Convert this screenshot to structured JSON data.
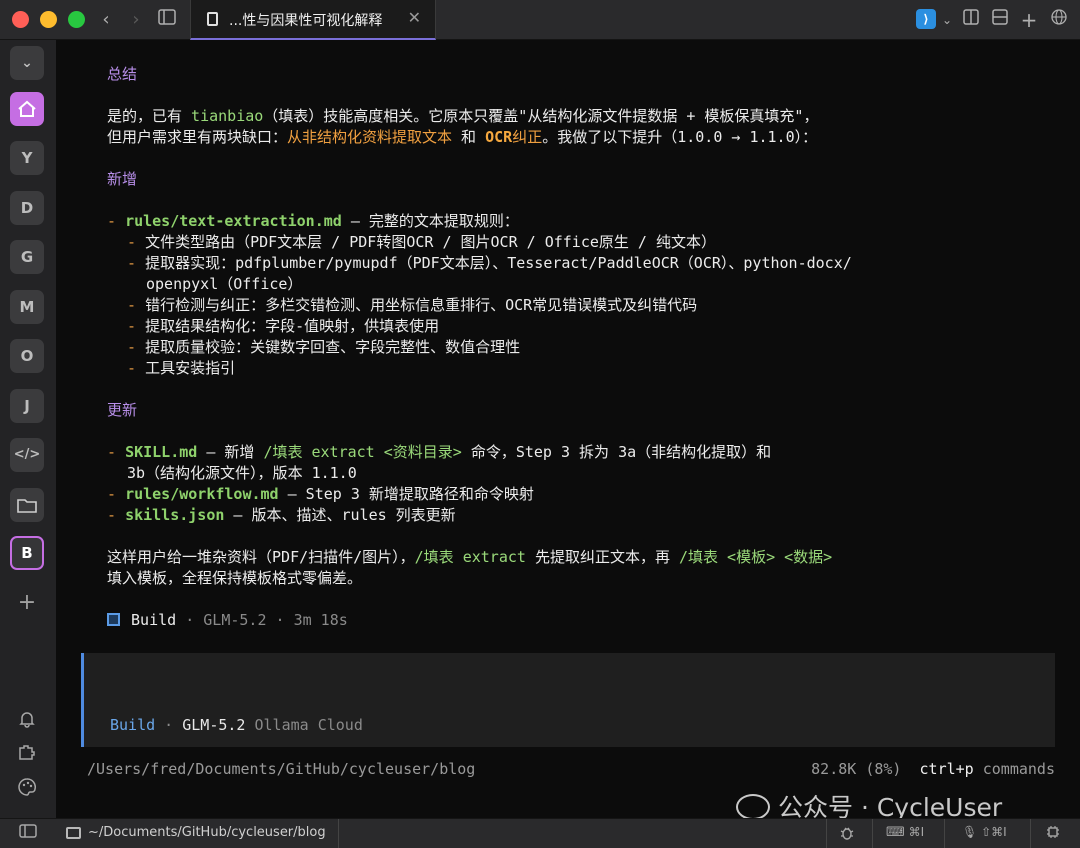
{
  "tab": {
    "title": "...性与因果性可视化解释",
    "close": "✕"
  },
  "sidebar": {
    "collapse": "⌄",
    "home": "⌂",
    "workspaces": [
      "Y",
      "D",
      "G",
      "M",
      "O",
      "J",
      "</>",
      "▭",
      "B"
    ],
    "add": "+",
    "bell": "🔔",
    "plugin": "⧉",
    "palette": "◔",
    "panel": "▭"
  },
  "content": {
    "h1": "总结",
    "p1_a": "是的，已有 ",
    "p1_code": "tianbiao",
    "p1_b": "（填表）技能高度相关。它原本只覆盖\"从结构化源文件提数据 + 模板保真填充\"，",
    "p2_a": "但用户需求里有两块缺口：",
    "p2_o1": "从非结构化资料提取文本",
    "p2_b": " 和 ",
    "p2_o2": "OCR",
    "p2_o3": "纠正",
    "p2_c": "。我做了以下提升（1.0.0 → 1.1.0）：",
    "h2": "新增",
    "n1_code": "rules/text-extraction.md",
    "n1_text": " — 完整的文本提取规则：",
    "n_items": [
      "文件类型路由（PDF文本层 / PDF转图OCR / 图片OCR / Office原生 / 纯文本）",
      "提取器实现：pdfplumber/pymupdf（PDF文本层）、Tesseract/PaddleOCR（OCR）、python-docx/",
      "错行检测与纠正：多栏交错检测、用坐标信息重排行、OCR常见错误模式及纠错代码",
      "提取结果结构化：字段-值映射，供填表使用",
      "提取质量校验：关键数字回查、字段完整性、数值合理性",
      "工具安装指引"
    ],
    "n_item2_cont": "openpyxl（Office）",
    "h3": "更新",
    "u1_code": "SKILL.md",
    "u1_a": " — 新增 ",
    "u1_cmd": "/填表 extract <资料目录>",
    "u1_b": " 命令，Step 3 拆为 3a（非结构化提取）和",
    "u1_cont": "3b（结构化源文件），版本 1.1.0",
    "u2_code": "rules/workflow.md",
    "u2_text": " — Step 3 新增提取路径和命令映射",
    "u3_code": "skills.json",
    "u3_text": " — 版本、描述、rules 列表更新",
    "s1_a": "这样用户给一堆杂资料（PDF/扫描件/图片），",
    "s1_cmd1": "/填表 extract",
    "s1_b": " 先提取纠正文本，再 ",
    "s1_cmd2": "/填表 <模板> <数据>",
    "s2": "填入模板，全程保持模板格式零偏差。",
    "build_label": "Build",
    "build_meta": " · GLM-5.2 · 3m 18s",
    "bullet": "-"
  },
  "input": {
    "mode": "Build",
    "sep": " · ",
    "model": "GLM-5.2",
    "provider": " Ollama Cloud"
  },
  "status": {
    "path": "/Users/fred/Documents/GitHub/cycleuser/blog",
    "tokens": "82.8K (8%)",
    "shortcut": "ctrl+p",
    "shortcut_label": " commands"
  },
  "watermark": "公众号 · CycleUser",
  "bottombar": {
    "path": "~/Documents/GitHub/cycleuser/blog",
    "shortcut1": "⌘I",
    "shortcut2": "⇧⌘I"
  }
}
